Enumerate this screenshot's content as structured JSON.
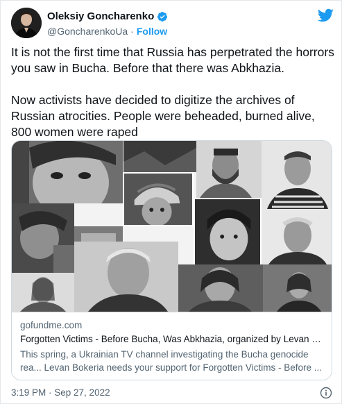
{
  "author": {
    "name": "Oleksiy Goncharenko",
    "handle": "@GoncharenkoUa",
    "separator": "·",
    "follow_label": "Follow"
  },
  "icons": {
    "verified": "verified-badge-icon",
    "brand": "twitter-bird-icon",
    "info": "info-icon"
  },
  "colors": {
    "accent": "#1d9bf0",
    "text": "#0f1419",
    "secondary": "#536471",
    "border": "#cfd9de"
  },
  "tweet": {
    "paragraph_1": "It is not the first time that Russia has perpetrated the horrors you saw in Bucha. Before that there was Abkhazia.",
    "paragraph_2": "Now activists have decided to digitize the archives of Russian atrocities. People were beheaded, burned alive, 800 women were raped"
  },
  "link_card": {
    "domain": "gofundme.com",
    "title": "Forgotten Victims - Before Bucha, Was Abkhazia, organized by Levan Bo...",
    "description": "This spring, a Ukrainian TV channel investigating the Bucha genocide rea... Levan Bokeria needs your support for Forgotten Victims - Before ..."
  },
  "footer": {
    "timestamp": "3:19 PM · Sep 27, 2022"
  }
}
